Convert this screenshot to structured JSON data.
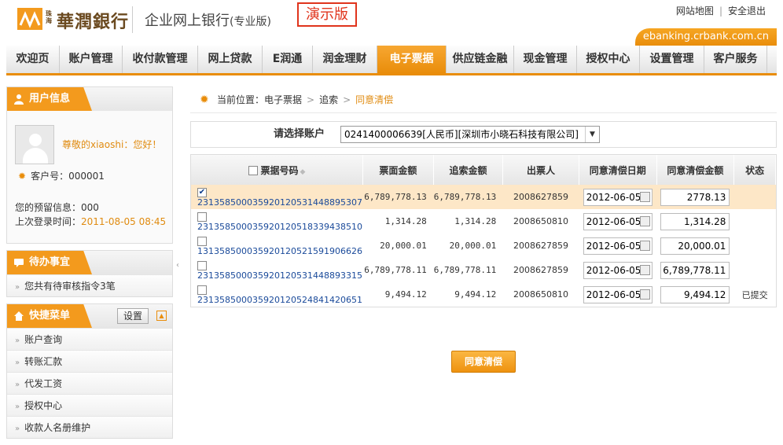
{
  "header": {
    "bank_small": "珠海",
    "bank_name": "華潤銀行",
    "product_title": "企业网上银行",
    "product_edition": "(专业版)",
    "demo_badge": "演示版",
    "site_map": "网站地图",
    "separator": "|",
    "logout": "安全退出",
    "domain": "ebanking.crbank.com.cn",
    "brand_color": "#e98d0b"
  },
  "nav": {
    "items": [
      {
        "label": "欢迎页"
      },
      {
        "label": "账户管理"
      },
      {
        "label": "收付款管理"
      },
      {
        "label": "网上贷款"
      },
      {
        "label": "E润通"
      },
      {
        "label": "润金理财"
      },
      {
        "label": "电子票据"
      },
      {
        "label": "供应链金融"
      },
      {
        "label": "现金管理"
      },
      {
        "label": "授权中心"
      },
      {
        "label": "设置管理"
      },
      {
        "label": "客户服务"
      }
    ],
    "active_index": 6
  },
  "user_panel": {
    "title": "用户信息",
    "greeting": "尊敬的xiaoshi：您好！",
    "customer_label": "客户号：",
    "customer_no": "000001",
    "reserve_label": "您的预留信息：",
    "reserve_value": "000",
    "last_login_label": "上次登录时间：",
    "last_login_value": "2011-08-05 08:45"
  },
  "todo_panel": {
    "title": "待办事宜",
    "items": [
      {
        "label": "您共有待审核指令3笔"
      }
    ]
  },
  "shortcut_panel": {
    "title": "快捷菜单",
    "settings_label": "设置",
    "items": [
      {
        "label": "账户查询"
      },
      {
        "label": "转账汇款"
      },
      {
        "label": "代发工资"
      },
      {
        "label": "授权中心"
      },
      {
        "label": "收款人名册维护"
      }
    ]
  },
  "breadcrumb": {
    "prefix": "当前位置：",
    "items": [
      "电子票据",
      "追索",
      "同意清偿"
    ],
    "sep": ">"
  },
  "account": {
    "label": "请选择账户",
    "selected": "0241400006639[人民币][深圳市小晓石科技有限公司]"
  },
  "table": {
    "headers": [
      "票据号码",
      "票面金额",
      "追索金额",
      "出票人",
      "同意清偿日期",
      "同意清偿金额",
      "状态"
    ],
    "rows": [
      {
        "checked": true,
        "bill_no": "231358500035920120531448895307",
        "face_amount": "6,789,778.13",
        "recourse_amount": "6,789,778.13",
        "drawer": "2008627859",
        "date": "2012-06-05",
        "pay_amount": "2778.13",
        "status": ""
      },
      {
        "checked": false,
        "bill_no": "231358500035920120518339438510",
        "face_amount": "1,314.28",
        "recourse_amount": "1,314.28",
        "drawer": "2008650810",
        "date": "2012-06-05",
        "pay_amount": "1,314.28",
        "status": ""
      },
      {
        "checked": false,
        "bill_no": "131358500035920120521591906626",
        "face_amount": "20,000.01",
        "recourse_amount": "20,000.01",
        "drawer": "2008627859",
        "date": "2012-06-05",
        "pay_amount": "20,000.01",
        "status": ""
      },
      {
        "checked": false,
        "bill_no": "231358500035920120531448893315",
        "face_amount": "6,789,778.11",
        "recourse_amount": "6,789,778.11",
        "drawer": "2008627859",
        "date": "2012-06-05",
        "pay_amount": "6,789,778.11",
        "status": ""
      },
      {
        "checked": false,
        "bill_no": "231358500035920120524841420651",
        "face_amount": "9,494.12",
        "recourse_amount": "9,494.12",
        "drawer": "2008650810",
        "date": "2012-06-05",
        "pay_amount": "9,494.12",
        "status": "已提交"
      }
    ]
  },
  "actions": {
    "confirm_label": "同意清偿"
  }
}
